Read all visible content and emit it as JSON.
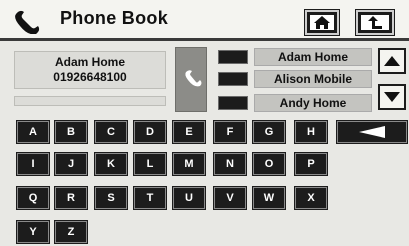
{
  "header": {
    "title": "Phone Book"
  },
  "contact": {
    "name": "Adam Home",
    "number": "01926648100"
  },
  "list": {
    "entries": [
      "Adam Home",
      "Alison Mobile",
      "Andy Home"
    ]
  },
  "keyboard": {
    "keys": [
      "A",
      "B",
      "C",
      "D",
      "E",
      "F",
      "G",
      "H",
      "I",
      "J",
      "K",
      "L",
      "M",
      "N",
      "O",
      "P",
      "Q",
      "R",
      "S",
      "T",
      "U",
      "V",
      "W",
      "X",
      "Y",
      "Z"
    ]
  },
  "icons": {
    "title": "handset-icon",
    "home": "home-icon",
    "back": "back-arrow-icon",
    "call": "handset-icon",
    "scroll_up": "triangle-up-icon",
    "scroll_down": "triangle-down-icon",
    "backspace": "backspace-arrow-icon"
  }
}
